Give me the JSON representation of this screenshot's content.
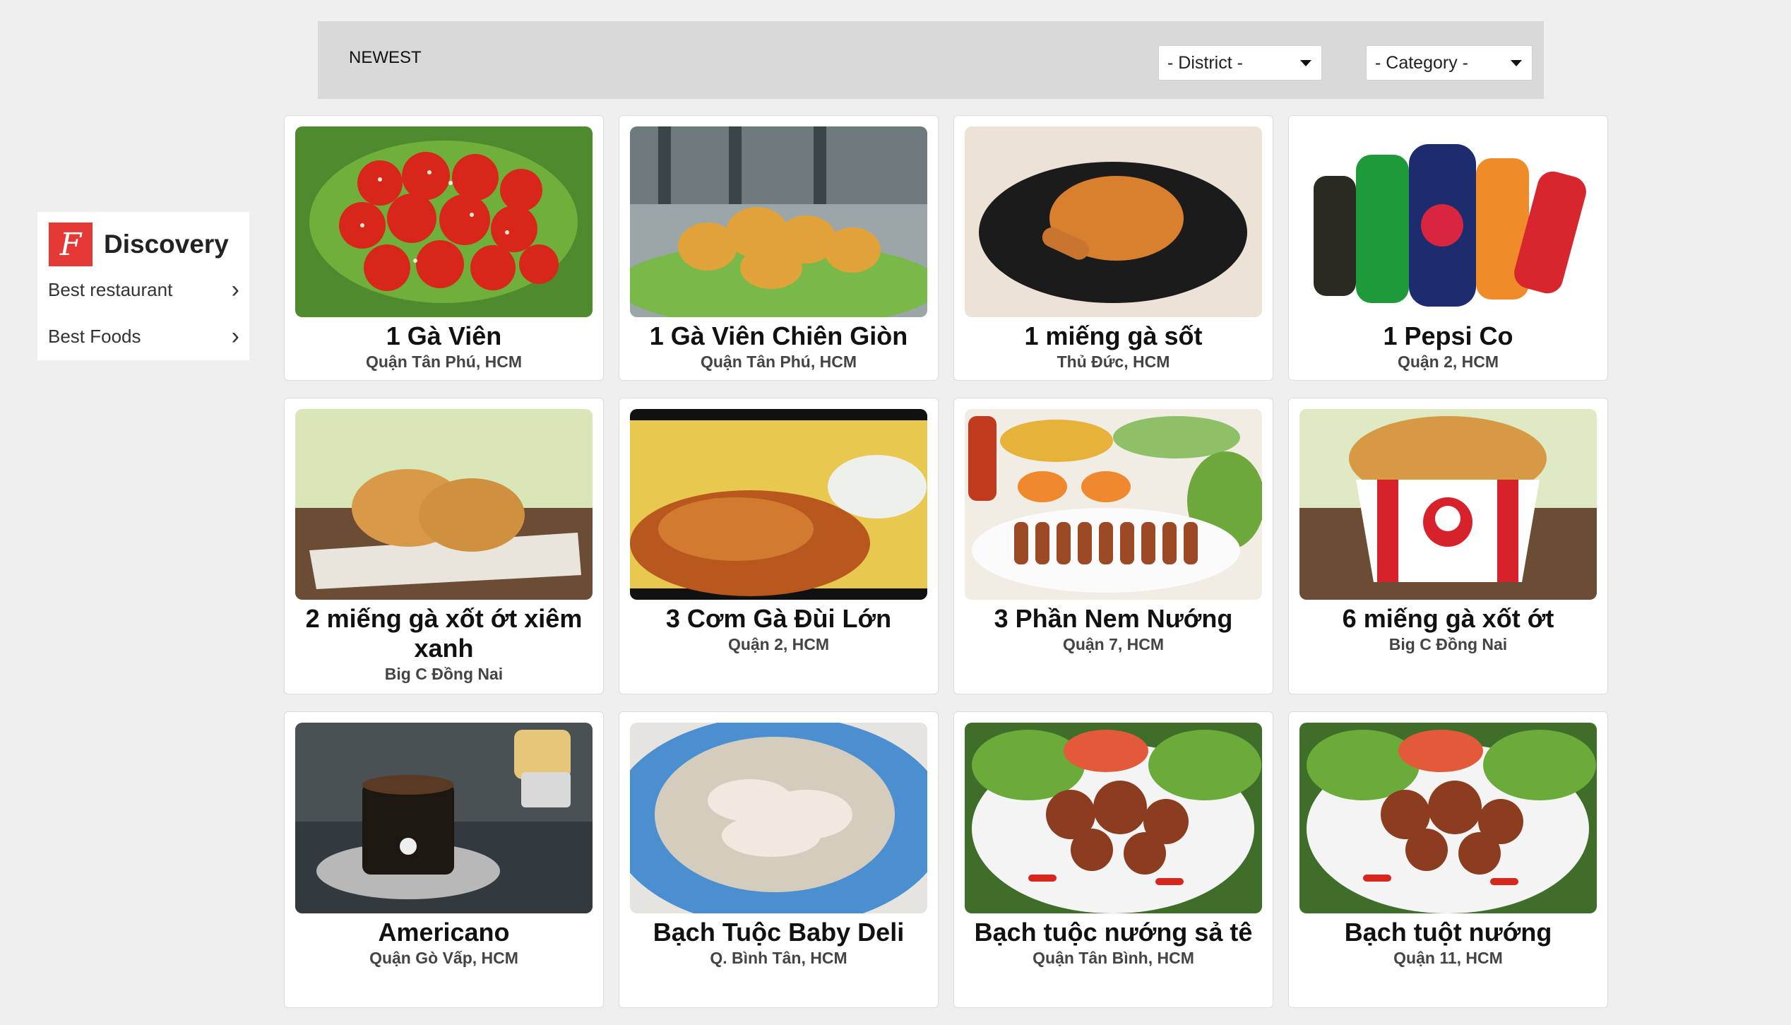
{
  "sidebar": {
    "logo_letter": "F",
    "brand": "Discovery",
    "items": [
      {
        "label": "Best restaurant"
      },
      {
        "label": "Best Foods"
      }
    ]
  },
  "filter": {
    "sort_label": "NEWEST",
    "district_value": "- District -",
    "category_value": "- Category -"
  },
  "foods": [
    {
      "name": "1 Gà Viên",
      "location": "Quận Tân Phú, HCM",
      "image": "spicy-chicken-balls"
    },
    {
      "name": "1 Gà Viên Chiên Giòn",
      "location": "Quận Tân Phú, HCM",
      "image": "crispy-chicken"
    },
    {
      "name": "1 miếng gà sốt",
      "location": "Thủ Đức, HCM",
      "image": "chicken-drumstick-plate"
    },
    {
      "name": "1 Pepsi Co",
      "location": "Quận 2, HCM",
      "image": "soft-drink-bottles"
    },
    {
      "name": "2 miếng gà xốt ớt xiêm xanh",
      "location": "Big C Đồng Nai",
      "image": "fried-chicken-pieces"
    },
    {
      "name": "3 Cơm Gà Đùi Lớn",
      "location": "Quận 2, HCM",
      "image": "chicken-rice"
    },
    {
      "name": "3 Phần Nem Nướng",
      "location": "Quận 7, HCM",
      "image": "grilled-pork-rolls"
    },
    {
      "name": "6 miếng gà xốt ớt",
      "location": "Big C Đồng Nai",
      "image": "chicken-bucket"
    },
    {
      "name": "Americano",
      "location": "Quận Gò Vấp, HCM",
      "image": "coffee-cup"
    },
    {
      "name": "Bạch Tuộc Baby Deli",
      "location": "Q. Bình Tân, HCM",
      "image": "octopus-plate"
    },
    {
      "name": "Bạch tuộc nướng sả tê",
      "location": "Quận Tân Bình, HCM",
      "image": "grilled-octopus"
    },
    {
      "name": "Bạch tuột nướng",
      "location": "Quận 11, HCM",
      "image": "grilled-octopus"
    }
  ],
  "colors": {
    "accent": "#e53935",
    "page_bg": "#efefef",
    "filter_bg": "#d9d9d9"
  }
}
